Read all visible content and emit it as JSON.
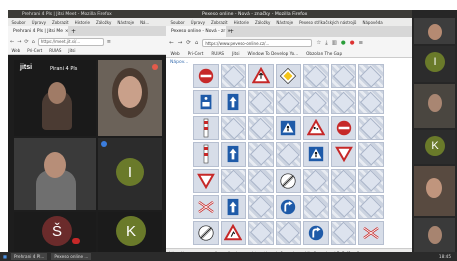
{
  "colors": {
    "accent_red": "#c62828",
    "sign_blue": "#1e5aa8",
    "jitsi_bg": "#1d1d1d",
    "avatar_olive": "#6a7a2a",
    "avatar_maroon": "#6b2b2b"
  },
  "left_window": {
    "title": "Prehrani 4 Pls | Jitsi Meet - Mozilla Firefox",
    "menu": [
      "Soubor",
      "Úpravy",
      "Zobrazit",
      "Historie",
      "Záložky",
      "Nástroje",
      "Ná..."
    ],
    "tab_label": "Prehrani 4 Pls | Jitsi Me",
    "url": "https://meet.jit.si/...",
    "bookmarks": [
      "Web",
      "Pri-Cert",
      "RUIAS",
      "Jitsi"
    ],
    "room_name": "Pirani 4 Pls",
    "logo": "jitsi",
    "participants": [
      {
        "initial": "I",
        "label": "I"
      },
      {
        "initial": "Š",
        "label": "Š"
      },
      {
        "initial": "K",
        "label": "K"
      }
    ]
  },
  "right_window": {
    "title": "Pexeso online - Nová - značky - Mozilla Firefox",
    "menu": [
      "Soubor",
      "Úpravy",
      "Zobrazit",
      "Historie",
      "Záložky",
      "Nástroje",
      "Pexeso stříkačských nástrojů",
      "Nápověda"
    ],
    "tab_label": "Pexeso online - Nová - zr",
    "url": "https://www.peveso-online.cz/...",
    "bookmarks": [
      "Web",
      "Pri-Cert",
      "RUIAS",
      "Jitsi",
      "Window To Develop Yo...",
      "Obzolan The Gap"
    ],
    "page_header": "Nápov...",
    "status_url": "https://www.pexeso-online.cz/hra/nova-mistnost/znacky?roomkey=ddba6erwnbgwhBxFuf&u=1"
  },
  "board": {
    "rows": 7,
    "cols": 7,
    "cards": [
      "noentry",
      "back",
      "warn_merge",
      "priority",
      "back",
      "back",
      "back",
      "ped",
      "oneway_up",
      "back",
      "back",
      "back",
      "back",
      "back",
      "yellow_post",
      "back",
      "back",
      "warn_ped",
      "warn_children",
      "noentry",
      "back",
      "yellow_post",
      "oneway_up",
      "back",
      "back",
      "warn_ped",
      "yield",
      "back",
      "yield",
      "back",
      "back",
      "speed_end",
      "back",
      "back",
      "back",
      "crossing",
      "oneway_up",
      "back",
      "turn_right",
      "back",
      "back",
      "back",
      "speed_end",
      "warn_works",
      "back",
      "back",
      "turn_right",
      "back",
      "crossing",
      "noentry",
      "back",
      "back",
      "back",
      "back",
      "back",
      "roundabout_noentry"
    ]
  },
  "side_panel": {
    "avatars": [
      {
        "initial": "I"
      },
      {
        "initial": "K"
      }
    ]
  },
  "taskbar": {
    "items": [
      "Prehrani 4 Pl...",
      "Pexeso online ...",
      "18:45"
    ]
  }
}
